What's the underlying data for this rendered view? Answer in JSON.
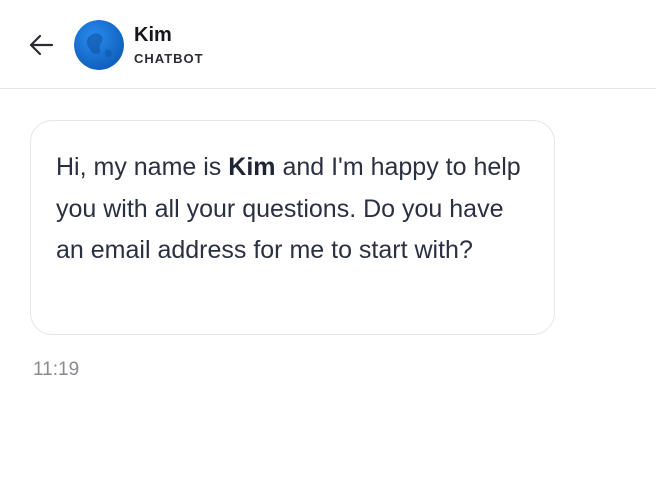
{
  "header": {
    "bot_name": "Kim",
    "bot_role": "CHATBOT",
    "back_icon": "arrow-left-icon",
    "avatar_color": "#1672d4"
  },
  "messages": [
    {
      "text_before": "Hi, my name is ",
      "text_bold": "Kim",
      "text_after": " and I'm happy to help you with all your questions. Do you have an email address for me to start with?",
      "time": "11:19"
    }
  ]
}
